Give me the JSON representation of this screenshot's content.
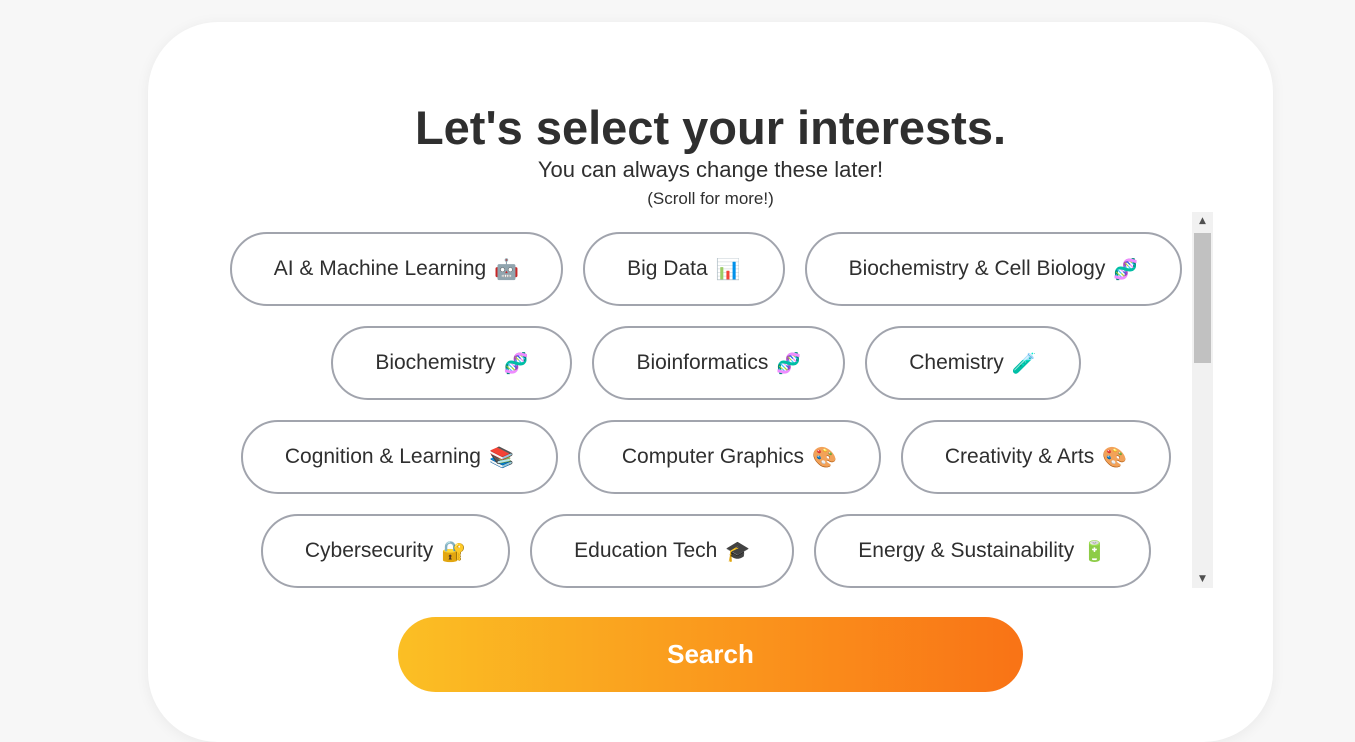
{
  "header": {
    "title": "Let's select your interests.",
    "subtitle": "You can always change these later!",
    "hint": "(Scroll for more!)"
  },
  "interests": [
    {
      "label": "AI & Machine Learning",
      "emoji": "🤖"
    },
    {
      "label": "Big Data",
      "emoji": "📊"
    },
    {
      "label": "Biochemistry & Cell Biology",
      "emoji": "🧬"
    },
    {
      "label": "Biochemistry",
      "emoji": "🧬"
    },
    {
      "label": "Bioinformatics",
      "emoji": "🧬"
    },
    {
      "label": "Chemistry",
      "emoji": "🧪"
    },
    {
      "label": "Cognition & Learning",
      "emoji": "📚"
    },
    {
      "label": "Computer Graphics",
      "emoji": "🎨"
    },
    {
      "label": "Creativity & Arts",
      "emoji": "🎨"
    },
    {
      "label": "Cybersecurity",
      "emoji": "🔐"
    },
    {
      "label": "Education Tech",
      "emoji": "🎓"
    },
    {
      "label": "Energy & Sustainability",
      "emoji": "🔋"
    }
  ],
  "search_button": {
    "label": "Search"
  },
  "colors": {
    "gradient_start": "#fbbf24",
    "gradient_end": "#f97316",
    "chip_border": "#a1a4ad",
    "text": "#2f2f2f"
  }
}
